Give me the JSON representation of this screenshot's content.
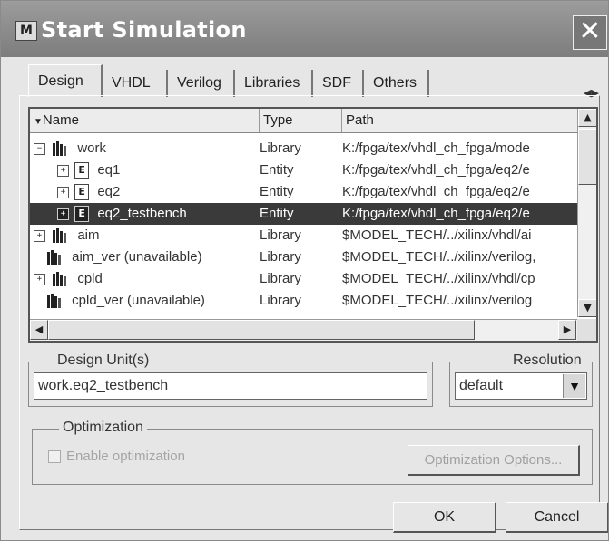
{
  "window": {
    "title": "Start Simulation",
    "app_icon": "modelsim-icon",
    "close_glyph": "✕"
  },
  "tabs": [
    {
      "label": "Design",
      "active": true
    },
    {
      "label": "VHDL"
    },
    {
      "label": "Verilog"
    },
    {
      "label": "Libraries"
    },
    {
      "label": "SDF"
    },
    {
      "label": "Others"
    }
  ],
  "tab_scroll_glyph": "◀▶",
  "library_list": {
    "columns": {
      "name": "Name",
      "type": "Type",
      "path": "Path"
    },
    "sort_glyph": "▼",
    "rows": [
      {
        "name": "work",
        "type": "Library",
        "path": "K:/fpga/tex/vhdl_ch_fpga/mode",
        "kind": "library",
        "expanded": true
      },
      {
        "name": "eq1",
        "type": "Entity",
        "path": "K:/fpga/tex/vhdl_ch_fpga/eq2/e",
        "kind": "entity"
      },
      {
        "name": "eq2",
        "type": "Entity",
        "path": "K:/fpga/tex/vhdl_ch_fpga/eq2/e",
        "kind": "entity"
      },
      {
        "name": "eq2_testbench",
        "type": "Entity",
        "path": "K:/fpga/tex/vhdl_ch_fpga/eq2/e",
        "kind": "entity",
        "selected": true
      },
      {
        "name": "aim",
        "type": "Library",
        "path": "$MODEL_TECH/../xilinx/vhdl/ai",
        "kind": "library"
      },
      {
        "name": "aim_ver (unavailable)",
        "type": "Library",
        "path": "$MODEL_TECH/../xilinx/verilog,",
        "kind": "library"
      },
      {
        "name": "cpld",
        "type": "Library",
        "path": "$MODEL_TECH/../xilinx/vhdl/cp",
        "kind": "library"
      },
      {
        "name": "cpld_ver (unavailable)",
        "type": "Library",
        "path": "$MODEL_TECH/../xilinx/verilog",
        "kind": "library"
      }
    ],
    "entity_glyph": "E",
    "expand_glyph": "+",
    "collapse_glyph": "−"
  },
  "scroll_glyphs": {
    "up": "▲",
    "down": "▼",
    "left": "◀",
    "right": "▶"
  },
  "design_units": {
    "label": "Design Unit(s)",
    "value": "work.eq2_testbench"
  },
  "resolution": {
    "label": "Resolution",
    "value": "default",
    "arrow": "▼"
  },
  "optimization": {
    "label": "Optimization",
    "checkbox_label": "Enable optimization",
    "enabled": false,
    "options_button": "Optimization Options..."
  },
  "buttons": {
    "ok": "OK",
    "cancel": "Cancel"
  }
}
